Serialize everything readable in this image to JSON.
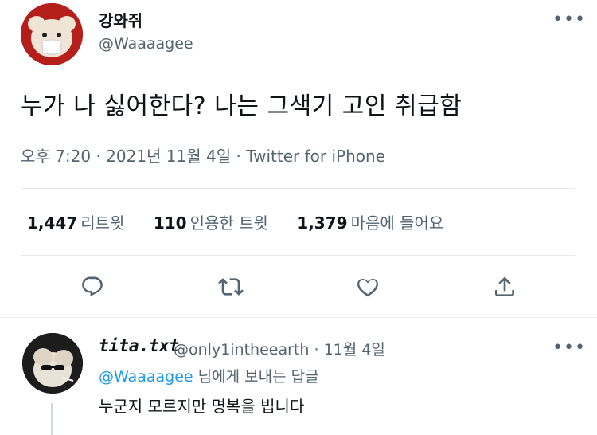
{
  "tweet": {
    "display_name": "강와쥐",
    "handle": "@Waaaagee",
    "text": "누가 나 싫어한다? 나는 그색기 고인 취급함",
    "time": "오후 7:20",
    "sep1": "·",
    "date": "2021년 11월 4일",
    "sep2": "·",
    "source": "Twitter for iPhone",
    "more": "•••"
  },
  "stats": {
    "retweets": {
      "count": "1,447",
      "label": "리트윗"
    },
    "quotes": {
      "count": "110",
      "label": "인용한 트윗"
    },
    "likes": {
      "count": "1,379",
      "label": "마음에 들어요"
    }
  },
  "actions": [
    "reply-icon",
    "retweet-icon",
    "like-icon",
    "share-icon"
  ],
  "reply": {
    "display_name": "tita.txt",
    "handle": "@only1intheearth",
    "sep": "·",
    "date": "11월 4일",
    "replying_mention": "@Waaaagee",
    "replying_suffix": " 님에게 보내는 답글",
    "text": "누군지 모르지만 명복을 빕니다",
    "more": "•••"
  },
  "colors": {
    "accent": "#1d9bf0",
    "secondary": "#536471",
    "avatar_bg": "#b41f1c"
  }
}
